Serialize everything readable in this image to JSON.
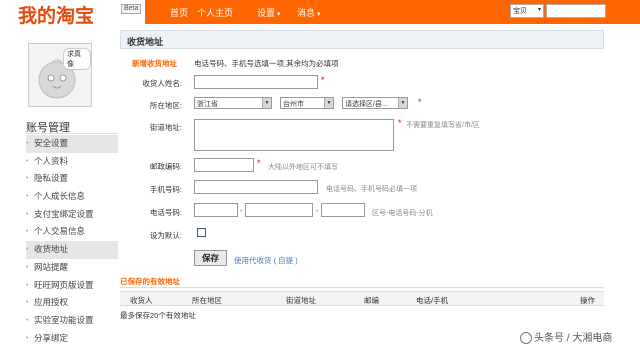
{
  "header": {
    "logo": "我的淘宝",
    "beta": "Beta",
    "nav": [
      {
        "label": "首页",
        "dropdown": false
      },
      {
        "label": "个人主页",
        "dropdown": false
      },
      {
        "label": "设置",
        "dropdown": true
      },
      {
        "label": "消息",
        "dropdown": true
      }
    ],
    "search_type": "宝贝"
  },
  "sidebar": {
    "avatar_badge": "求真像",
    "title": "账号管理",
    "items": [
      {
        "label": "安全设置",
        "active": true
      },
      {
        "label": "个人资料",
        "active": false
      },
      {
        "label": "隐私设置",
        "active": false
      },
      {
        "label": "个人成长信息",
        "active": false
      },
      {
        "label": "支付宝绑定设置",
        "active": false
      },
      {
        "label": "个人交易信息",
        "active": false
      },
      {
        "label": "收货地址",
        "active": true
      },
      {
        "label": "网站提醒",
        "active": false
      },
      {
        "label": "旺旺网页版设置",
        "active": false
      },
      {
        "label": "应用授权",
        "active": false
      },
      {
        "label": "实验室功能设置",
        "active": false
      },
      {
        "label": "分享绑定",
        "active": false
      }
    ]
  },
  "main": {
    "title": "收货地址",
    "new_section": "新增收货地址",
    "new_note": "电话号码、手机号选填一项,其余均为必填项",
    "form": {
      "name_label": "收货人姓名:",
      "region_label": "所在地区:",
      "province": "浙江省",
      "city": "台州市",
      "district": "请选择区/县...",
      "street_label": "街道地址:",
      "street_hint": "不需要重复填写省/市/区",
      "zip_label": "邮政编码:",
      "zip_hint": "大陆以外地区可不填写",
      "mobile_label": "手机号码:",
      "mobile_hint": "电话号码、手机号码必填一项",
      "phone_label": "电话号码:",
      "phone_sep": "-",
      "phone_hint": "区号-电话号码-分机",
      "default_label": "设为默认:",
      "save": "保存",
      "agent": "使用代收货",
      "agent_link": "( 自提 )"
    },
    "saved_section": "已保存的有效地址",
    "table_headers": [
      "收货人",
      "所在地区",
      "街道地址",
      "邮编",
      "电话/手机",
      "操作"
    ],
    "max_note": "最多保存20个有效地址"
  },
  "watermark": "头条号 / 大湘电商"
}
